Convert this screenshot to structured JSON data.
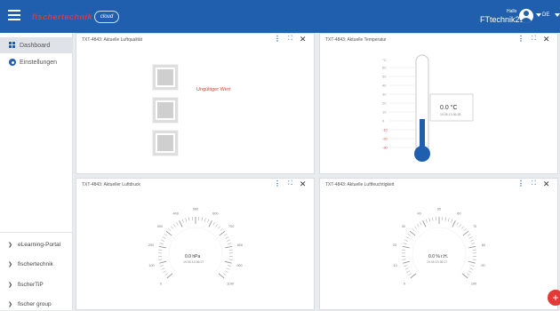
{
  "topbar": {
    "brand_word": "fischertechnik",
    "brand_cloud": "cloud",
    "greeting": "Hallo",
    "username": "FTtechnik21",
    "language": "DE",
    "color": "#1f5fad"
  },
  "sidebar": {
    "items": [
      {
        "label": "Dashboard",
        "icon": "grid-icon",
        "active": true
      },
      {
        "label": "Einstellungen",
        "icon": "gear-icon",
        "active": false
      }
    ],
    "links": [
      {
        "label": "eLearning-Portal"
      },
      {
        "label": "fischertechnik"
      },
      {
        "label": "fischerTiP"
      },
      {
        "label": "fischer group"
      }
    ]
  },
  "cards": {
    "air_quality": {
      "title": "TXT-4843: Aktuelle Luftqualität",
      "status": "Ungültiger Wert"
    },
    "temperature": {
      "title": "TXT-4843: Aktuelle Temperatur",
      "unit_label": "°C",
      "ticks": [
        "60",
        "50",
        "40",
        "30",
        "20",
        "10",
        "0",
        "-10",
        "-20",
        "-30"
      ],
      "value": "0.0 °C",
      "timestamp": "19.05.13:36:28"
    },
    "pressure": {
      "title": "TXT-4843: Aktueller Luftdruck",
      "ticks": [
        "0",
        "100",
        "200",
        "300",
        "400",
        "500",
        "600",
        "700",
        "800",
        "900",
        "1100"
      ],
      "value": "0.0 hPa",
      "timestamp": "19.05.13:36:27"
    },
    "humidity": {
      "title": "TXT-4843: Aktuelle Luftfeuchtigkeit",
      "ticks": [
        "0",
        "10",
        "20",
        "30",
        "40",
        "50",
        "60",
        "70",
        "80",
        "90",
        "100"
      ],
      "value": "0.0 % r.H.",
      "timestamp": "19.05.13:36:27"
    }
  },
  "colors": {
    "accent": "#1f5fad",
    "invalid": "#e53935",
    "fab": "#e53935"
  }
}
